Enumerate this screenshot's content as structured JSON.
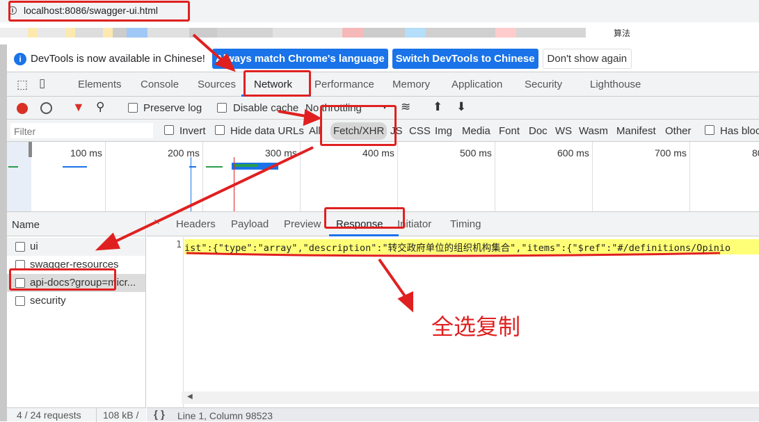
{
  "browser": {
    "url": "localhost:8086/swagger-ui.html",
    "bookmark_overflow": "算法"
  },
  "infobar": {
    "message": "DevTools is now available in Chinese!",
    "btn_match": "Always match Chrome's language",
    "btn_switch": "Switch DevTools to Chinese",
    "btn_dismiss": "Don't show again"
  },
  "tabs": [
    "Elements",
    "Console",
    "Sources",
    "Network",
    "Performance",
    "Memory",
    "Application",
    "Security",
    "Lighthouse"
  ],
  "active_tab": "Network",
  "toolbar": {
    "preserve_log": "Preserve log",
    "disable_cache": "Disable cache",
    "throttling": "No throttling"
  },
  "filter": {
    "placeholder": "Filter",
    "invert": "Invert",
    "hide_data_urls": "Hide data URLs",
    "types": [
      "All",
      "Fetch/XHR",
      "JS",
      "CSS",
      "Img",
      "Media",
      "Font",
      "Doc",
      "WS",
      "Wasm",
      "Manifest",
      "Other"
    ],
    "active_type": "Fetch/XHR",
    "has_blocked": "Has bloc"
  },
  "timeline": {
    "ticks": [
      "100 ms",
      "200 ms",
      "300 ms",
      "400 ms",
      "500 ms",
      "600 ms",
      "700 ms",
      "80"
    ]
  },
  "requests": {
    "header": "Name",
    "items": [
      "ui",
      "swagger-resources",
      "api-docs?group=micr...",
      "security"
    ],
    "selected": "api-docs?group=micr..."
  },
  "detail_tabs": [
    "Headers",
    "Payload",
    "Preview",
    "Response",
    "Initiator",
    "Timing"
  ],
  "active_detail_tab": "Response",
  "response": {
    "line_number": "1",
    "content": "ist\":{\"type\":\"array\",\"description\":\"转交政府单位的组织机构集合\",\"items\":{\"$ref\":\"#/definitions/Opinio"
  },
  "status": {
    "requests": "4 / 24 requests",
    "transferred": "108 kB /",
    "cursor": "Line 1, Column 98523"
  },
  "annotation": {
    "text": "全选复制",
    "color": "#e02020"
  },
  "colors": {
    "accent": "#1a73e8",
    "record": "#d93025",
    "highlight": "#ffff77"
  }
}
